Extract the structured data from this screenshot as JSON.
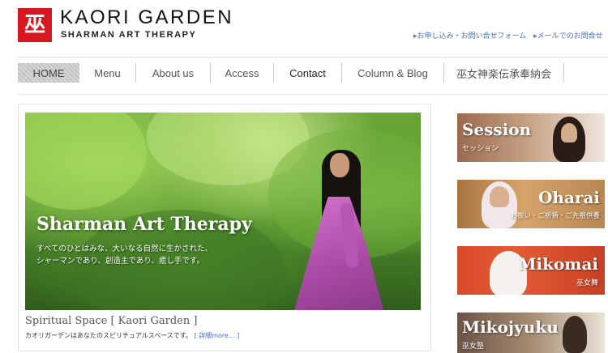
{
  "header": {
    "logo_glyph": "巫",
    "brand_name": "KAORI GARDEN",
    "brand_sub": "SHARMAN ART THERAPY",
    "top_links": [
      "▸お申し込み・お問い合せフォーム",
      "▸メールでのお問合せ"
    ]
  },
  "nav": {
    "items": [
      "HOME",
      "Menu",
      "About us",
      "Access",
      "Contact",
      "Column & Blog",
      "巫女神楽伝承奉納会"
    ]
  },
  "hero": {
    "title": "Sharman Art Therapy",
    "desc_line1": "すべてのひとはみな、大いなる自然に生かされた、",
    "desc_line2": "シャーマンであり、創造主であり、癒し手です。",
    "caption": "Spiritual Space [ Kaori Garden ]",
    "sub_text": "カオリガーデンはあなたのスピリチュアルスペースです。",
    "more_link": "[ 詳細more... ]"
  },
  "banners": [
    {
      "title": "Session",
      "sub": "セッション"
    },
    {
      "title": "Oharai",
      "sub": "お祓い・ご祈祷・ご先祖供養"
    },
    {
      "title": "Mikomai",
      "sub": "巫女舞"
    },
    {
      "title": "Mikojyuku",
      "sub": "巫女塾"
    }
  ]
}
